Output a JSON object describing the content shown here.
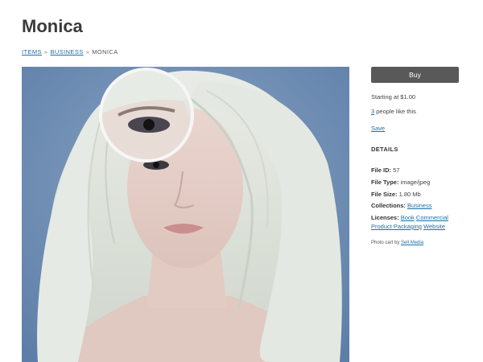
{
  "page": {
    "title": "Monica"
  },
  "breadcrumb": {
    "items": [
      {
        "label": "ITEMS",
        "link": true
      },
      {
        "label": "BUSINESS",
        "link": true
      },
      {
        "label": "MONICA",
        "link": false
      }
    ],
    "separator": "»"
  },
  "photo": {
    "magnifier_visible": true
  },
  "sidebar": {
    "buy_label": "Buy",
    "starting_at": "Starting at $1.00",
    "likes_count": "3",
    "likes_suffix": " people like this",
    "save_label": "Save",
    "details_heading": "DETAILS",
    "file_id_label": "File ID:",
    "file_id_value": "57",
    "file_type_label": "File Type:",
    "file_type_value": "image/jpeg",
    "file_size_label": "File Size:",
    "file_size_value": "1.80 Mb",
    "collections_label": "Collections:",
    "collections_value": "Business",
    "licenses_label": "Licenses:",
    "licenses": [
      "Book",
      "Commercial",
      "Product Packaging",
      "Website"
    ],
    "credit_prefix": "Photo cart by ",
    "credit_link": "Sell Media"
  },
  "colors": {
    "buy_button": "#595959",
    "link": "#1e6fa8",
    "photo_background": "#6f8fb5"
  }
}
